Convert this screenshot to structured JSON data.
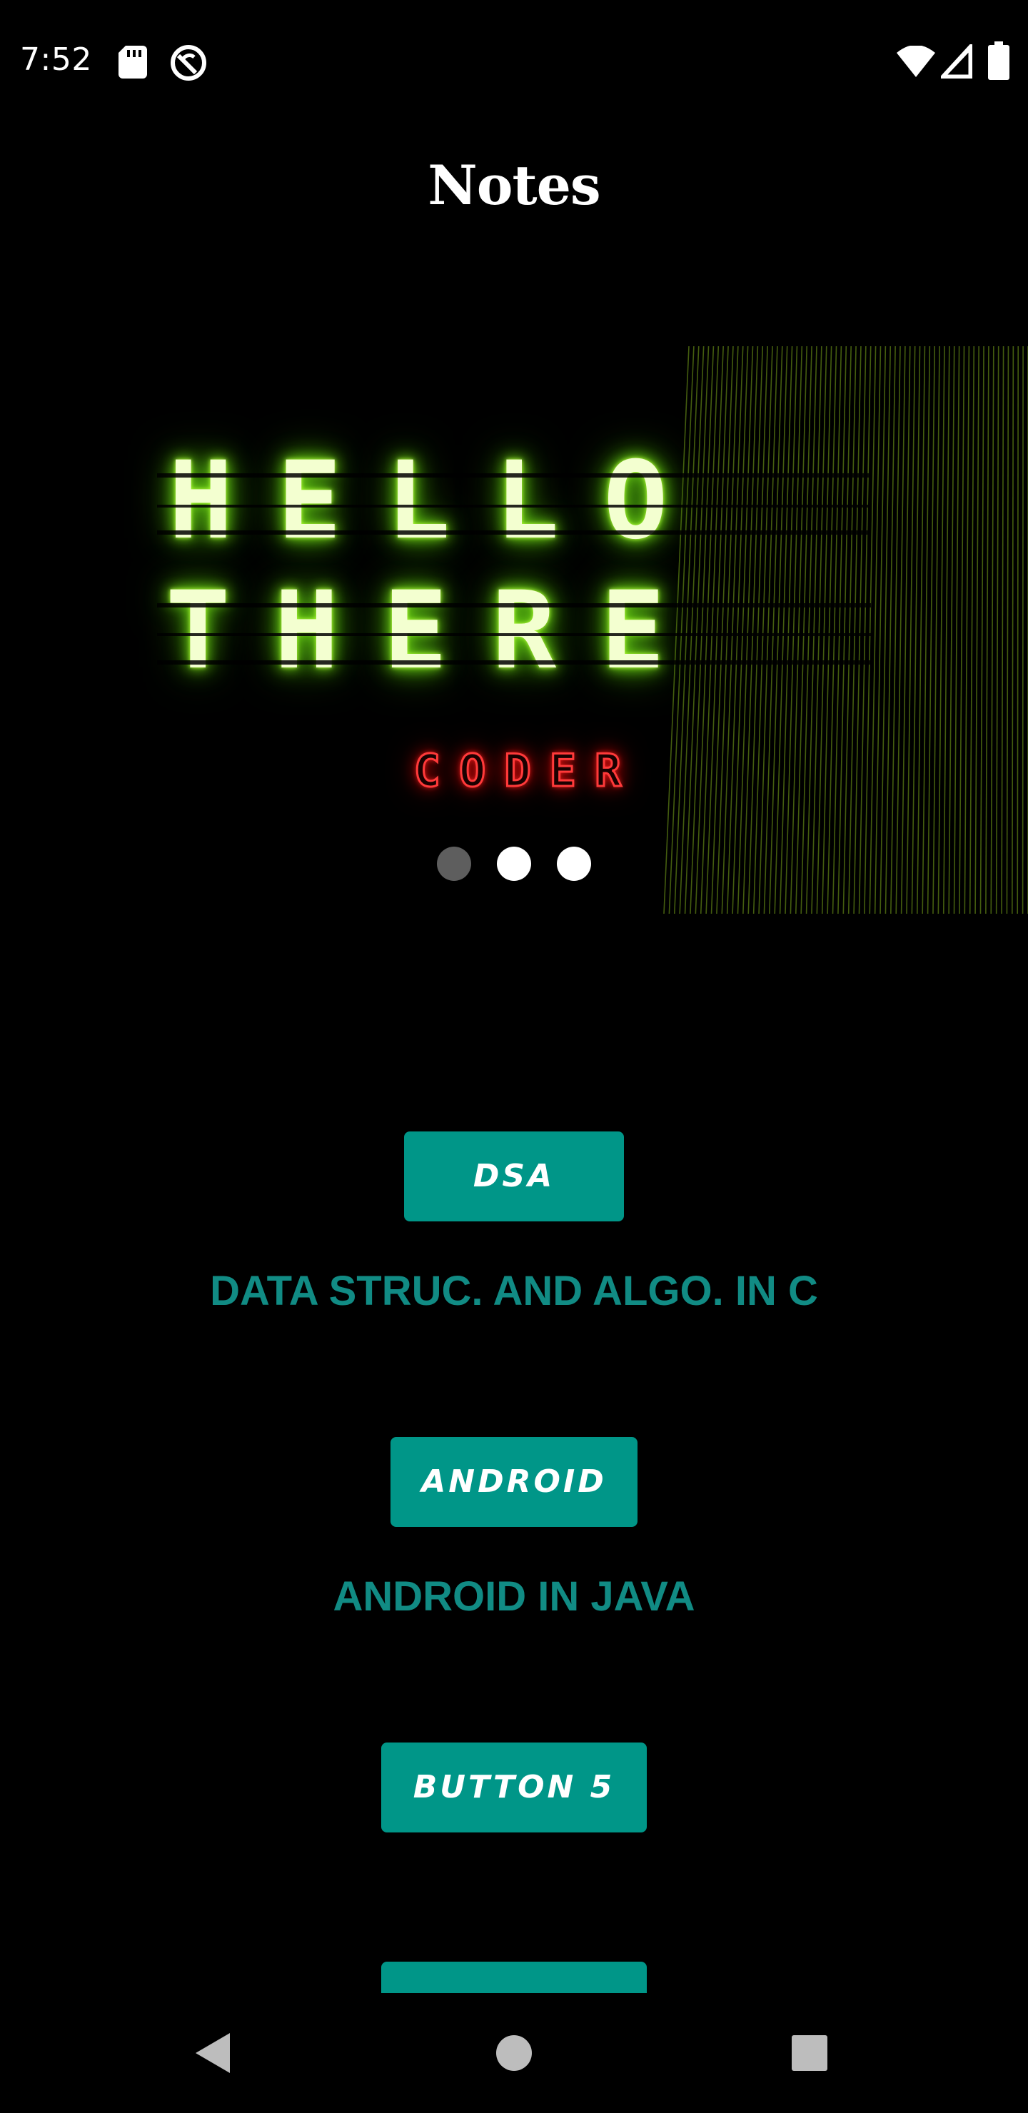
{
  "status_bar": {
    "time": "7:52",
    "icons": [
      "sd-card-icon",
      "sync-icon",
      "wifi-icon",
      "signal-icon",
      "battery-icon"
    ]
  },
  "app": {
    "title": "Notes"
  },
  "banner": {
    "line1": "HELLO",
    "line2": "THERE",
    "subtitle": "CODER",
    "pager": {
      "count": 3,
      "active": 1
    },
    "colors": {
      "glow": "#79e01a",
      "subtitle": "#ff1f1f"
    }
  },
  "buttons": [
    {
      "label": "DSA",
      "caption": "DATA STRUC. AND ALGO. IN C"
    },
    {
      "label": "ANDROID",
      "caption": "ANDROID IN JAVA"
    },
    {
      "label": "BUTTON 5"
    },
    {
      "label": ""
    }
  ],
  "nav_bar": {
    "icons": [
      "back-icon",
      "home-icon",
      "recents-icon"
    ]
  },
  "colors": {
    "background": "#000000",
    "button": "#009688",
    "caption": "#118b84"
  }
}
